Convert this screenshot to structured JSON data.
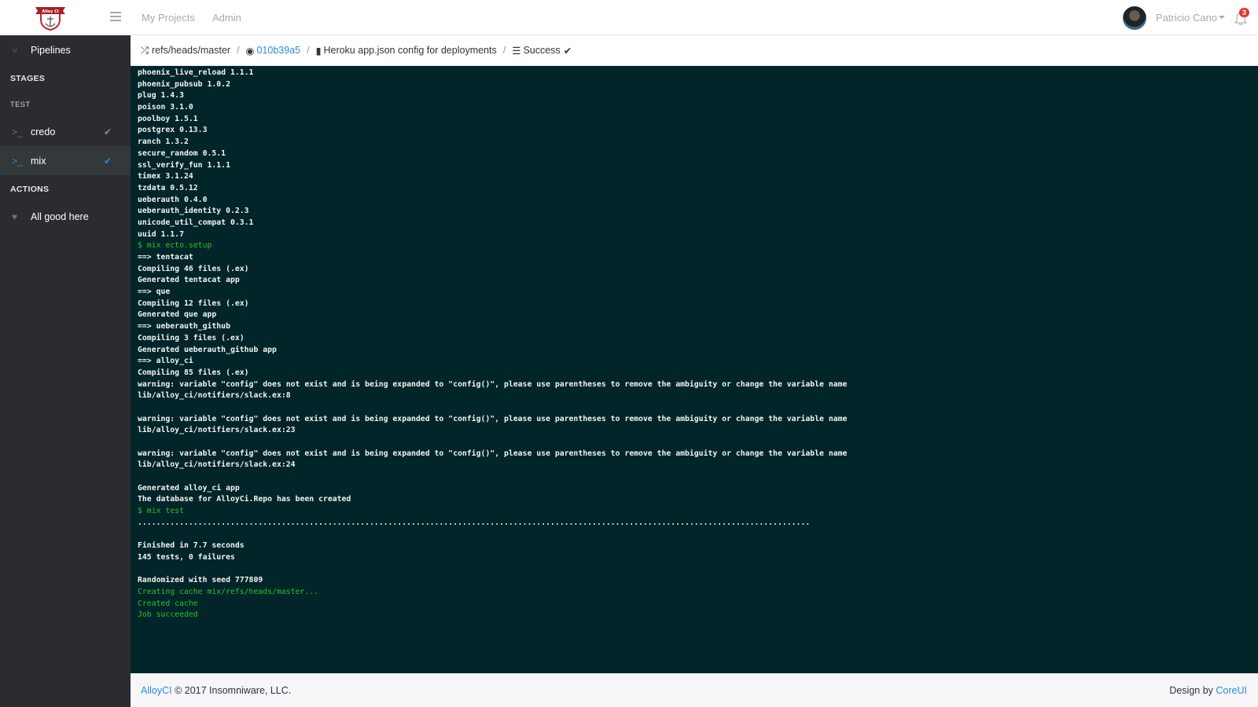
{
  "header": {
    "logo_text": "Alloy CI",
    "nav": [
      "My Projects",
      "Admin"
    ],
    "user_name": "Patricio Cano",
    "notifications_count": "3"
  },
  "sidebar": {
    "pipelines_label": "Pipelines",
    "stages_title": "STAGES",
    "stage_name": "TEST",
    "jobs": [
      {
        "label": "credo",
        "status": "success"
      },
      {
        "label": "mix",
        "status": "success",
        "active": true
      }
    ],
    "actions_title": "ACTIONS",
    "action_label": "All good here"
  },
  "breadcrumb": {
    "ref": "refs/heads/master",
    "commit": "010b39a5",
    "message": "Heroku app.json config for deployments",
    "status": "Success"
  },
  "console": {
    "lines": [
      {
        "t": "phoenix_live_reload 1.1.1"
      },
      {
        "t": "phoenix_pubsub 1.0.2"
      },
      {
        "t": "plug 1.4.3"
      },
      {
        "t": "poison 3.1.0"
      },
      {
        "t": "poolboy 1.5.1"
      },
      {
        "t": "postgrex 0.13.3"
      },
      {
        "t": "ranch 1.3.2"
      },
      {
        "t": "secure_random 0.5.1"
      },
      {
        "t": "ssl_verify_fun 1.1.1"
      },
      {
        "t": "timex 3.1.24"
      },
      {
        "t": "tzdata 0.5.12"
      },
      {
        "t": "ueberauth 0.4.0"
      },
      {
        "t": "ueberauth_identity 0.2.3"
      },
      {
        "t": "unicode_util_compat 0.3.1"
      },
      {
        "t": "uuid 1.1.7"
      },
      {
        "t": "$ mix ecto.setup",
        "g": true
      },
      {
        "t": "==> tentacat"
      },
      {
        "t": "Compiling 46 files (.ex)"
      },
      {
        "t": "Generated tentacat app"
      },
      {
        "t": "==> que"
      },
      {
        "t": "Compiling 12 files (.ex)"
      },
      {
        "t": "Generated que app"
      },
      {
        "t": "==> ueberauth_github"
      },
      {
        "t": "Compiling 3 files (.ex)"
      },
      {
        "t": "Generated ueberauth_github app"
      },
      {
        "t": "==> alloy_ci"
      },
      {
        "t": "Compiling 85 files (.ex)"
      },
      {
        "t": "warning: variable \"config\" does not exist and is being expanded to \"config()\", please use parentheses to remove the ambiguity or change the variable name"
      },
      {
        "t": "lib/alloy_ci/notifiers/slack.ex:8"
      },
      {
        "t": ""
      },
      {
        "t": "warning: variable \"config\" does not exist and is being expanded to \"config()\", please use parentheses to remove the ambiguity or change the variable name"
      },
      {
        "t": "lib/alloy_ci/notifiers/slack.ex:23"
      },
      {
        "t": ""
      },
      {
        "t": "warning: variable \"config\" does not exist and is being expanded to \"config()\", please use parentheses to remove the ambiguity or change the variable name"
      },
      {
        "t": "lib/alloy_ci/notifiers/slack.ex:24"
      },
      {
        "t": ""
      },
      {
        "t": "Generated alloy_ci app"
      },
      {
        "t": "The database for AlloyCi.Repo has been created"
      },
      {
        "t": "$ mix test",
        "g": true
      },
      {
        "t": "................................................................................................................................................."
      },
      {
        "t": ""
      },
      {
        "t": "Finished in 7.7 seconds"
      },
      {
        "t": "145 tests, 0 failures"
      },
      {
        "t": ""
      },
      {
        "t": "Randomized with seed 777809"
      },
      {
        "t": "Creating cache mix/refs/heads/master...",
        "g": true
      },
      {
        "t": "Created cache",
        "g": true
      },
      {
        "t": "Job succeeded",
        "g": true
      }
    ]
  },
  "footer": {
    "brand": "AlloyCI",
    "copyright": "© 2017 Insomniware, LLC.",
    "design_by": "Design by",
    "design_link": "CoreUI"
  }
}
